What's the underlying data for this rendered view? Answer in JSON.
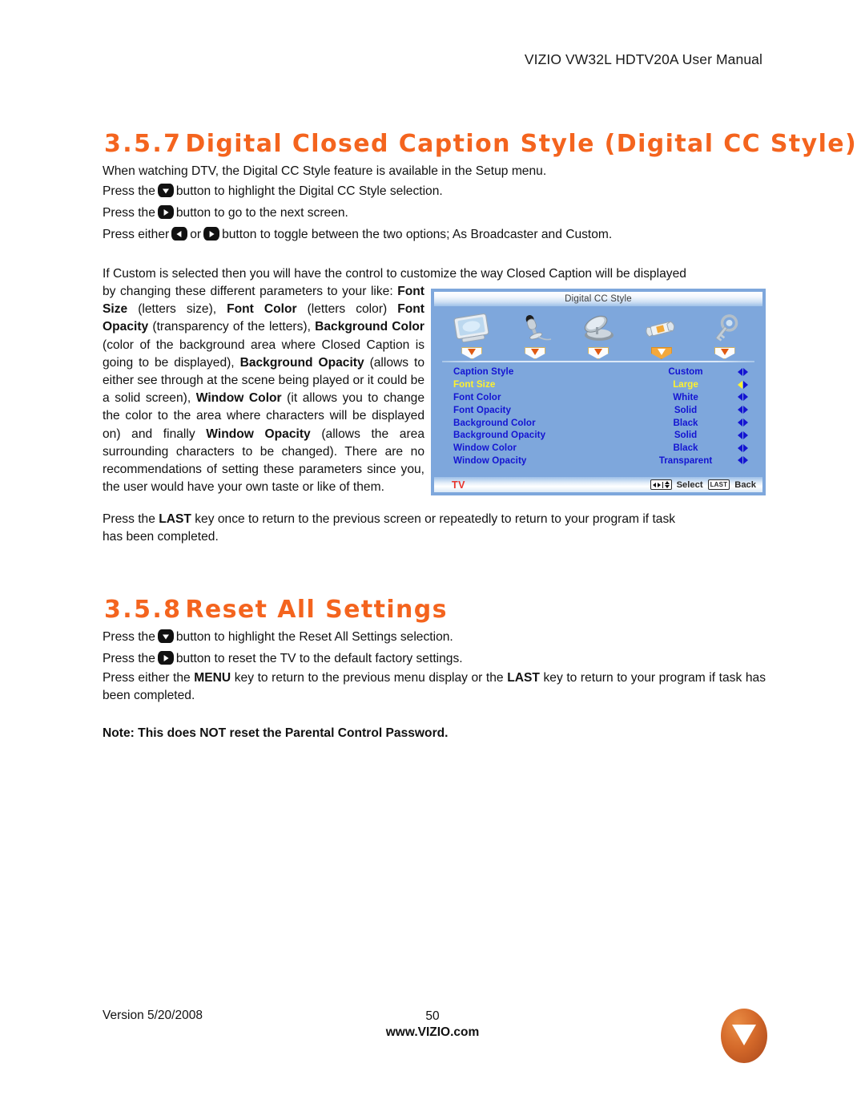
{
  "header": {
    "title": "VIZIO VW32L HDTV20A User Manual"
  },
  "sections": [
    {
      "number": "3.5.7",
      "title": "Digital Closed Caption Style (Digital CC Style)",
      "lines": [
        "When watching DTV, the Digital CC Style feature is available in the Setup menu.",
        "Press the",
        "button to highlight the Digital CC Style selection.",
        "Press the",
        "button to go to the next screen.",
        "Press either",
        "or",
        "button to toggle between the two options; As Broadcaster and Custom."
      ],
      "paragraph_intro": "If Custom is selected then you will have the control to customize the way Closed Caption will be displayed",
      "paragraph_wrapped": "by changing these different parameters to your like: Font Size (letters size), Font Color (letters color) Font Opacity (transparency of the letters), Background Color (color of the background area where Closed Caption is going to be displayed), Background Opacity (allows to either see through at the scene being played or it could be a solid screen), Window Color (it allows you to change the color to the area where characters will be displayed on) and finally Window Opacity (allows the area surrounding characters to be changed). There are no recommendations of setting these parameters since you, the user would have your own taste or like of them.",
      "closing_line_1": "Press the LAST key once to return to the previous screen or repeatedly to return to your program if task",
      "closing_line_2": "has been completed."
    },
    {
      "number": "3.5.8",
      "title": "Reset All Settings",
      "line_1_pre": "Press the",
      "line_1_post": "button to highlight the Reset All Settings selection.",
      "line_2_pre": "Press the",
      "line_2_post": "button to reset the TV to the default factory settings.",
      "line_3": "Press either the MENU key to return to the previous menu display or the LAST key to return to your",
      "line_4": "program if task has been completed.",
      "note": "Note: This does NOT reset the Parental Control Password."
    }
  ],
  "osd": {
    "title": "Digital CC Style",
    "icon_tabs": [
      {
        "name": "picture",
        "active": false
      },
      {
        "name": "audio",
        "active": false
      },
      {
        "name": "tuner",
        "active": false
      },
      {
        "name": "setup",
        "active": true
      },
      {
        "name": "parental",
        "active": false
      }
    ],
    "rows": [
      {
        "label": "Caption Style",
        "value": "Custom",
        "selected": false
      },
      {
        "label": "Font Size",
        "value": "Large",
        "selected": true
      },
      {
        "label": "Font Color",
        "value": "White",
        "selected": false
      },
      {
        "label": "Font Opacity",
        "value": "Solid",
        "selected": false
      },
      {
        "label": "Background Color",
        "value": "Black",
        "selected": false
      },
      {
        "label": "Background Opacity",
        "value": "Solid",
        "selected": false
      },
      {
        "label": "Window Color",
        "value": "Black",
        "selected": false
      },
      {
        "label": "Window Opacity",
        "value": "Transparent",
        "selected": false
      }
    ],
    "source_label": "TV",
    "hint_select": "Select",
    "hint_last_key": "LAST",
    "hint_back": "Back",
    "colors": {
      "background": "#7EA7DC",
      "label": "#1414D2",
      "selected": "#FFF22D",
      "source": "#E8342C"
    }
  },
  "footer": {
    "version": "Version 5/20/2008",
    "page_number": "50",
    "website": "www.VIZIO.com",
    "logo_letter": "V"
  },
  "theme": {
    "heading_color": "#F4641E"
  }
}
